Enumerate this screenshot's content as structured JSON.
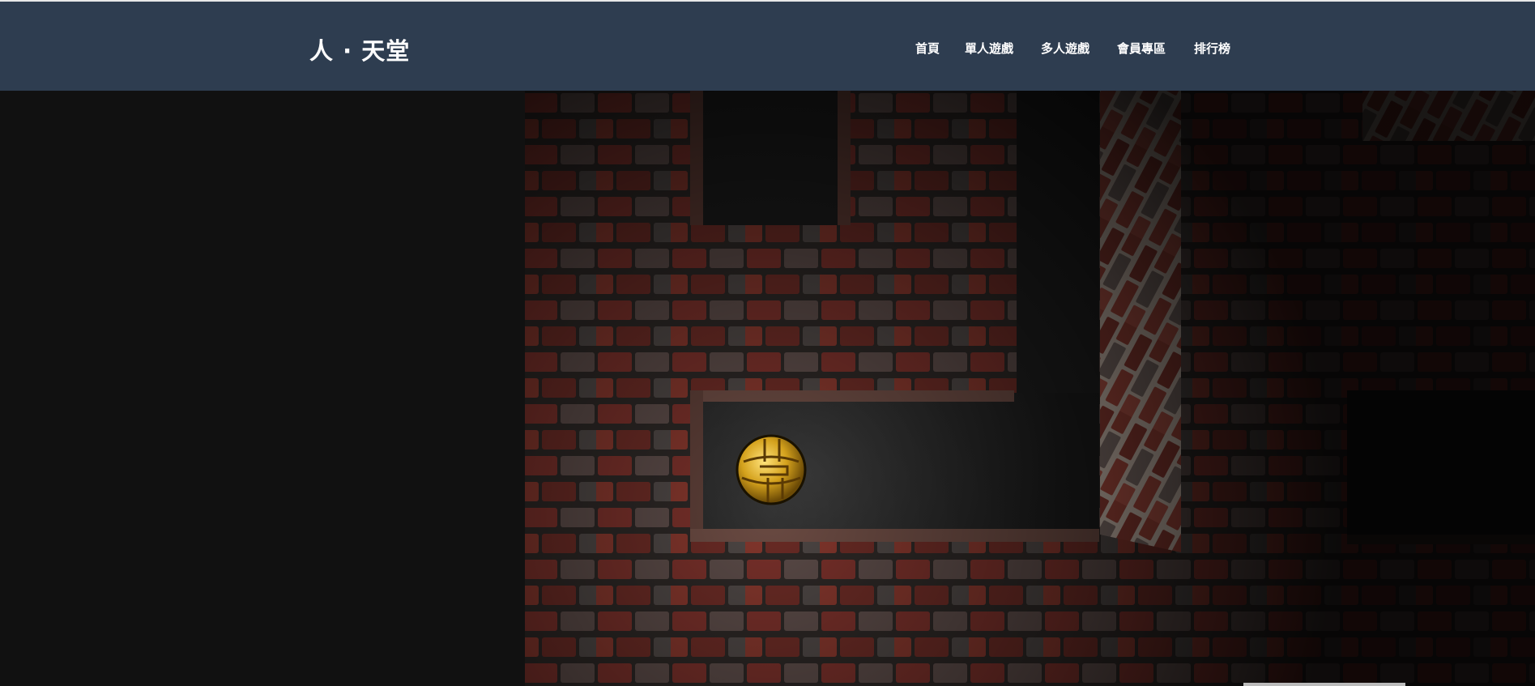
{
  "header": {
    "brand": "人 · 天堂",
    "nav": [
      {
        "label": "首頁"
      },
      {
        "label": "單人遊戲"
      },
      {
        "label": "多人遊戲"
      },
      {
        "label": "會員專區"
      },
      {
        "label": "排行榜"
      }
    ]
  },
  "game": {
    "type": "3d-maze",
    "colors": {
      "brick_mortar": "#2a2624",
      "brick_red": "#7a3028",
      "brick_grey": "#4a4442",
      "floor_dark": "#1c1c1c",
      "ball_gold": "#d9a81e"
    },
    "icons": {
      "player": "golden-ball-icon"
    }
  }
}
